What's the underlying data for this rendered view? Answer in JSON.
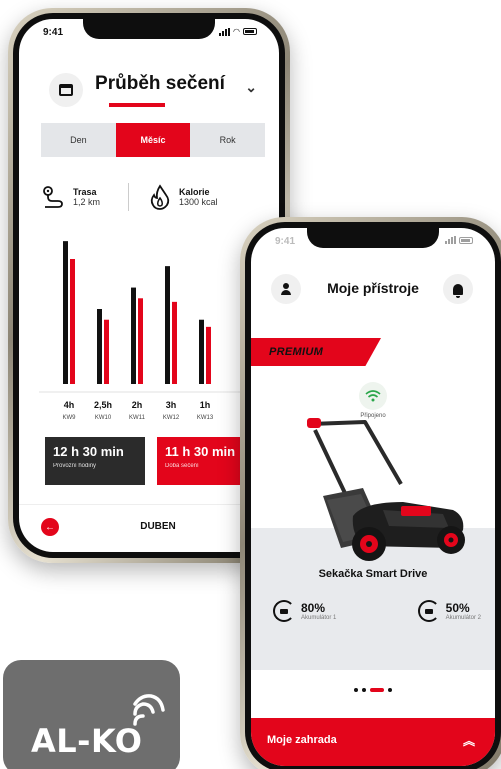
{
  "phone1": {
    "status_time": "9:41",
    "title": "Průběh sečení",
    "tabs": [
      {
        "label": "Den",
        "active": false
      },
      {
        "label": "Měsíc",
        "active": true
      },
      {
        "label": "Rok",
        "active": false
      }
    ],
    "metrics": {
      "route": {
        "label": "Trasa",
        "value": "1,2 km",
        "icon": "route-icon"
      },
      "calories": {
        "label": "Kalorie",
        "value": "1300 kcal",
        "icon": "flame-icon"
      }
    },
    "chart_data": {
      "type": "bar",
      "categories": [
        "KW9",
        "KW10",
        "KW11",
        "KW12",
        "KW13"
      ],
      "category_values": [
        "4h",
        "2,5h",
        "2h",
        "3h",
        "1h"
      ],
      "series": [
        {
          "values": [
            4.0,
            2.1,
            2.7,
            3.3,
            1.8
          ],
          "color": "#111111"
        },
        {
          "values": [
            3.5,
            1.8,
            2.4,
            2.3,
            1.6
          ],
          "color": "#e3051b"
        }
      ],
      "ylim": [
        0,
        4.2
      ],
      "grid": false,
      "title": "",
      "xlabel": "",
      "ylabel": ""
    },
    "totals": [
      {
        "value": "12 h 30 min",
        "label": "Provozní hodiny",
        "style": "dark"
      },
      {
        "value": "11 h 30 min",
        "label": "Doba sečení",
        "style": "red"
      }
    ],
    "footer": {
      "month": "DUBEN"
    }
  },
  "phone2": {
    "status_time": "9:41",
    "title": "Moje přístroje",
    "badge": "PREMIUM",
    "connection": "Připojeno",
    "device_name": "Sekačka Smart Drive",
    "batteries": [
      {
        "percent": "80%",
        "label": "Akumulátor 1"
      },
      {
        "percent": "50%",
        "label": "Akumulátor 2"
      }
    ],
    "footer_label": "Moje zahrada"
  },
  "logo": {
    "text": "AL-KO"
  },
  "colors": {
    "brand_red": "#e3051b",
    "dark": "#2b2b2b",
    "logo_gray": "#6e6e6e"
  }
}
